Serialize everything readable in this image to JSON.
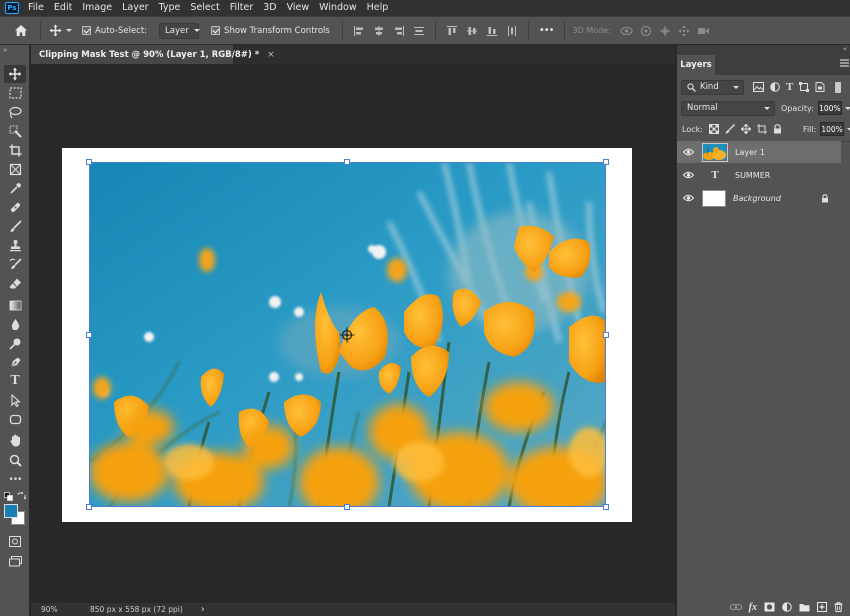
{
  "app": {
    "logo": "Ps"
  },
  "menu": [
    "File",
    "Edit",
    "Image",
    "Layer",
    "Type",
    "Select",
    "Filter",
    "3D",
    "View",
    "Window",
    "Help"
  ],
  "options": {
    "auto_select_label": "Auto-Select:",
    "auto_select_checked": true,
    "auto_select_target": "Layer",
    "transform_controls_label": "Show Transform Controls",
    "transform_controls_checked": true,
    "more_label": "•••",
    "mode_3d_label": "3D Mode:"
  },
  "tabs": {
    "document_title": "Clipping Mask Test @ 90% (Layer 1, RGB/8#) *",
    "close_glyph": "×"
  },
  "tools": {
    "items": [
      "move",
      "marquee",
      "lasso",
      "quick-select",
      "crop",
      "frame",
      "eyedropper",
      "healing",
      "brush",
      "clone-stamp",
      "history-brush",
      "eraser",
      "gradient",
      "blur",
      "dodge",
      "pen",
      "type",
      "path-select",
      "shape",
      "hand",
      "zoom",
      "more"
    ],
    "type_glyph": "T",
    "more_glyph": "•••",
    "foreground_color": "#1a7db5",
    "background_color": "#ffffff"
  },
  "status": {
    "zoom": "90%",
    "doc_info": "850 px x 558 px (72 ppi)",
    "arrow": "›"
  },
  "layers_panel": {
    "tab_label": "Layers",
    "filter_kind": "Kind",
    "blend_mode": "Normal",
    "opacity_label": "Opacity:",
    "opacity_value": "100%",
    "lock_label": "Lock:",
    "fill_label": "Fill:",
    "fill_value": "100%",
    "type_glyph": "T",
    "layers": [
      {
        "name": "Layer 1",
        "kind": "image",
        "selected": true,
        "italic": false,
        "locked": false
      },
      {
        "name": "SUMMER",
        "kind": "text",
        "selected": false,
        "italic": false,
        "locked": false
      },
      {
        "name": "Background",
        "kind": "fill",
        "selected": false,
        "italic": true,
        "locked": true
      }
    ]
  },
  "colors": {
    "ui_dark": "#282828",
    "panel": "#535353",
    "selection": "#4a7ed6",
    "accent": "#31a8ff"
  }
}
